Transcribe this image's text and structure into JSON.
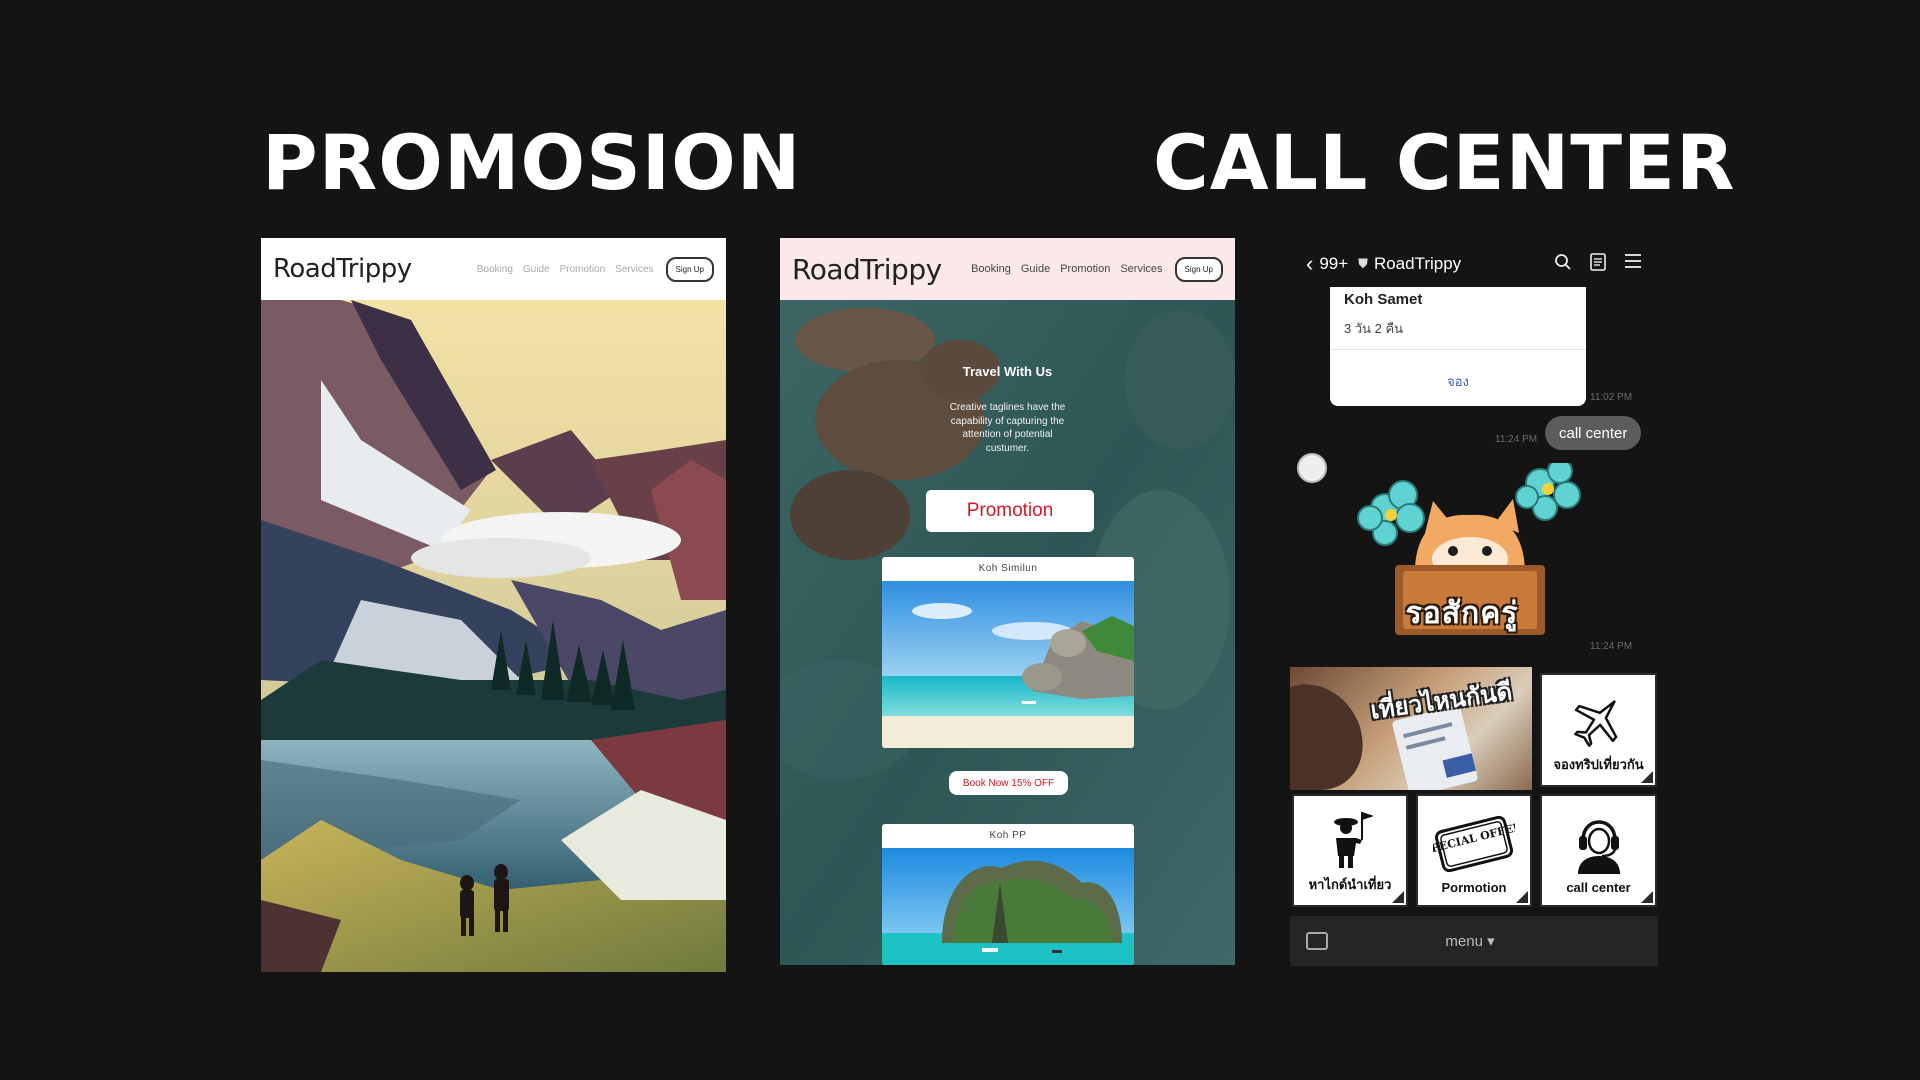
{
  "headings": {
    "promotion": "PROMOSION",
    "call_center": "CALL CENTER"
  },
  "site": {
    "logo": "RoadTrippy",
    "nav": [
      "Booking",
      "Guide",
      "Promotion",
      "Services"
    ],
    "signup": "Sign Up"
  },
  "promo_page": {
    "hero_title": "Travel With Us",
    "hero_sub": "Creative taglines have the capability of capturing the attention of potential custumer.",
    "promo_button": "Promotion",
    "cards": [
      {
        "title": "Koh Similun"
      },
      {
        "title": "Koh PP"
      }
    ],
    "book_button": "Book Now 15% OFF"
  },
  "chat": {
    "back_count": "99+",
    "name": "RoadTrippy",
    "card": {
      "title": "Koh Samet",
      "subtitle": "3 วัน 2 คืน",
      "action": "จอง"
    },
    "times": {
      "card": "11:02 PM",
      "user": "11:24 PM",
      "sticker": "11:24 PM"
    },
    "user_message": "call center",
    "sticker_text": "รอสักครู่",
    "rich_menu": {
      "banner_text": "เที่ยวไหนกันดี",
      "tiles": [
        {
          "label": "จองทริปเที่ยวกัน",
          "icon": "airplane-icon"
        },
        {
          "label": "หาไกด์นำเที่ยว",
          "icon": "guide-icon"
        },
        {
          "label": "Pormotion",
          "icon": "special-offer-stamp-icon",
          "stamp": "SPECIAL OFFER"
        },
        {
          "label": "call center",
          "icon": "headset-agent-icon"
        }
      ]
    },
    "footer_menu": "menu ▾"
  },
  "colors": {
    "background": "#141414",
    "promo_red": "#d8162a",
    "user_bubble": "#5c5c5c"
  }
}
